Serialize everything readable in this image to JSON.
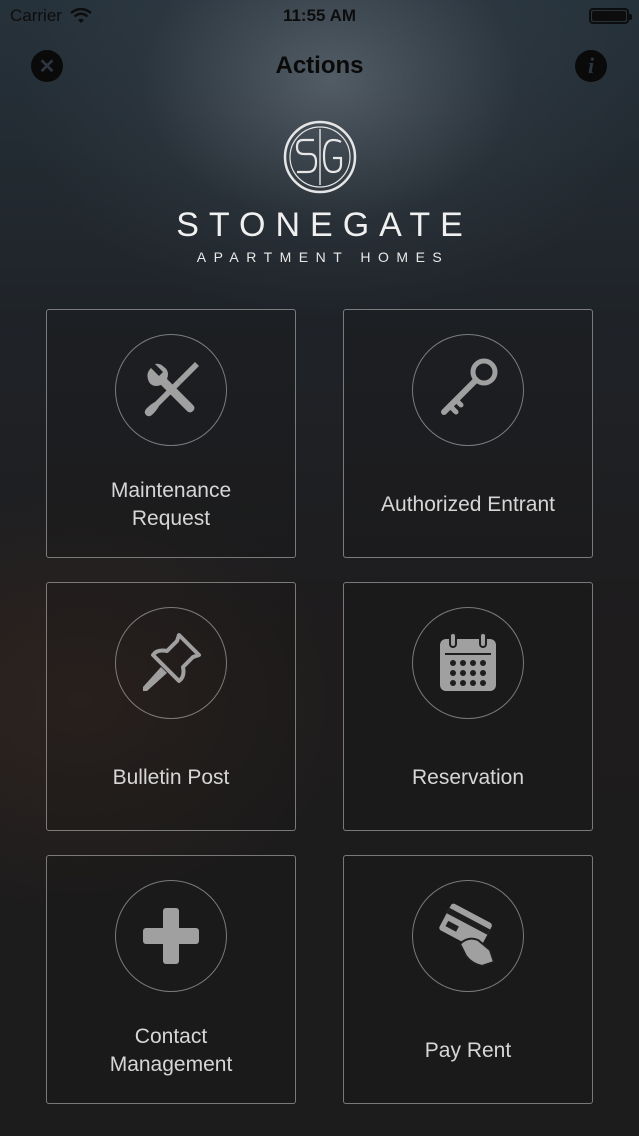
{
  "status_bar": {
    "carrier": "Carrier",
    "time": "11:55 AM"
  },
  "nav": {
    "title": "Actions",
    "close_icon": "close-icon",
    "info_icon": "info-icon"
  },
  "brand": {
    "monogram": "SG",
    "name": "STONEGATE",
    "tagline": "APARTMENT HOMES"
  },
  "actions": [
    {
      "label": "Maintenance\nRequest",
      "icon": "tools-icon"
    },
    {
      "label": "Authorized Entrant",
      "icon": "key-icon"
    },
    {
      "label": "Bulletin Post",
      "icon": "pushpin-icon"
    },
    {
      "label": "Reservation",
      "icon": "calendar-icon"
    },
    {
      "label": "Contact\nManagement",
      "icon": "plus-icon"
    },
    {
      "label": "Pay Rent",
      "icon": "credit-card-icon"
    }
  ],
  "colors": {
    "icon_gray": "#9a9a9a",
    "status_text": "#0d0d0d"
  }
}
